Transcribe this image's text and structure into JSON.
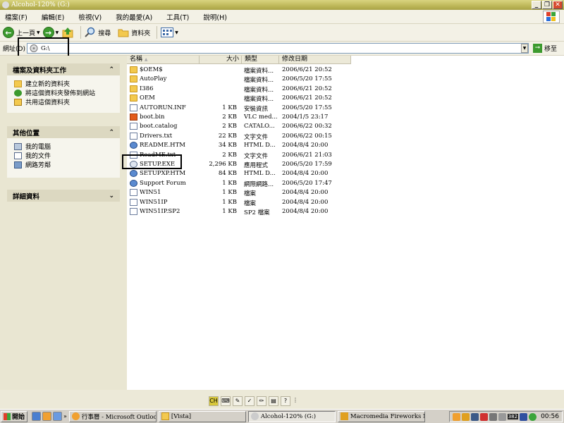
{
  "window": {
    "title": "Alcohol-120% (G:)",
    "controls": [
      "_",
      "❐",
      "✕"
    ]
  },
  "menu": [
    "檔案(F)",
    "編輯(E)",
    "檢視(V)",
    "我的最愛(A)",
    "工具(T)",
    "說明(H)"
  ],
  "toolbar": {
    "back": "上一頁",
    "search": "搜尋",
    "folders": "資料夾"
  },
  "address": {
    "label": "網址(D)",
    "value": "G:\\",
    "go": "移至"
  },
  "panels": {
    "file_tasks": {
      "title": "檔案及資料夾工作",
      "items": [
        "建立新的資料夾",
        "將這個資料夾發佈到網站",
        "共用這個資料夾"
      ]
    },
    "other_places": {
      "title": "其他位置",
      "items": [
        "我的電腦",
        "我的文件",
        "網路芳鄰"
      ]
    },
    "details": {
      "title": "詳細資料"
    }
  },
  "columns": {
    "name": "名稱",
    "size": "大小",
    "type": "類型",
    "date": "修改日期"
  },
  "files": [
    {
      "name": "$OEM$",
      "size": "",
      "type": "檔案資料...",
      "date": "2006/6/21 20:52",
      "icon": "folder"
    },
    {
      "name": "AutoPlay",
      "size": "",
      "type": "檔案資料...",
      "date": "2006/5/20 17:55",
      "icon": "folder"
    },
    {
      "name": "I386",
      "size": "",
      "type": "檔案資料...",
      "date": "2006/6/21 20:52",
      "icon": "folder"
    },
    {
      "name": "OEM",
      "size": "",
      "type": "檔案資料...",
      "date": "2006/6/21 20:52",
      "icon": "folder"
    },
    {
      "name": "AUTORUN.INF",
      "size": "1 KB",
      "type": "安裝資訊",
      "date": "2006/5/20 17:55",
      "icon": "doc"
    },
    {
      "name": "boot.bin",
      "size": "2 KB",
      "type": "VLC med...",
      "date": "2004/1/5 23:17",
      "icon": "vlc"
    },
    {
      "name": "boot.catalog",
      "size": "2 KB",
      "type": "CATALO...",
      "date": "2006/6/22 00:32",
      "icon": "doc"
    },
    {
      "name": "Drivers.txt",
      "size": "22 KB",
      "type": "文字文件",
      "date": "2006/6/22 00:15",
      "icon": "doc"
    },
    {
      "name": "README.HTM",
      "size": "34 KB",
      "type": "HTML D...",
      "date": "2004/8/4 20:00",
      "icon": "htm"
    },
    {
      "name": "ReadME.txt",
      "size": "2 KB",
      "type": "文字文件",
      "date": "2006/6/21 21:03",
      "icon": "doc"
    },
    {
      "name": "SETUP.EXE",
      "size": "2,296 KB",
      "type": "應用程式",
      "date": "2006/5/20 17:59",
      "icon": "exe"
    },
    {
      "name": "SETUPXP.HTM",
      "size": "84 KB",
      "type": "HTML D...",
      "date": "2004/8/4 20:00",
      "icon": "htm"
    },
    {
      "name": "Support Forum",
      "size": "1 KB",
      "type": "網際網路...",
      "date": "2006/5/20 17:47",
      "icon": "htm"
    },
    {
      "name": "WIN51",
      "size": "1 KB",
      "type": "檔案",
      "date": "2004/8/4 20:00",
      "icon": "doc"
    },
    {
      "name": "WIN51IP",
      "size": "1 KB",
      "type": "檔案",
      "date": "2004/8/4 20:00",
      "icon": "doc"
    },
    {
      "name": "WIN51IP.SP2",
      "size": "1 KB",
      "type": "SP2 檔案",
      "date": "2004/8/4 20:00",
      "icon": "doc"
    }
  ],
  "taskbar": {
    "start": "開始",
    "tasks": [
      "行事曆 - Microsoft Outlook",
      "[Vista]",
      "Alcohol-120% (G:)",
      "Macromedia Fireworks M..."
    ],
    "tray_badge": "382",
    "clock": "00:56"
  },
  "colors": {
    "titlebar": "#bdb758",
    "folder": "#f3c94e",
    "pane_bg": "#e9e6d2"
  }
}
